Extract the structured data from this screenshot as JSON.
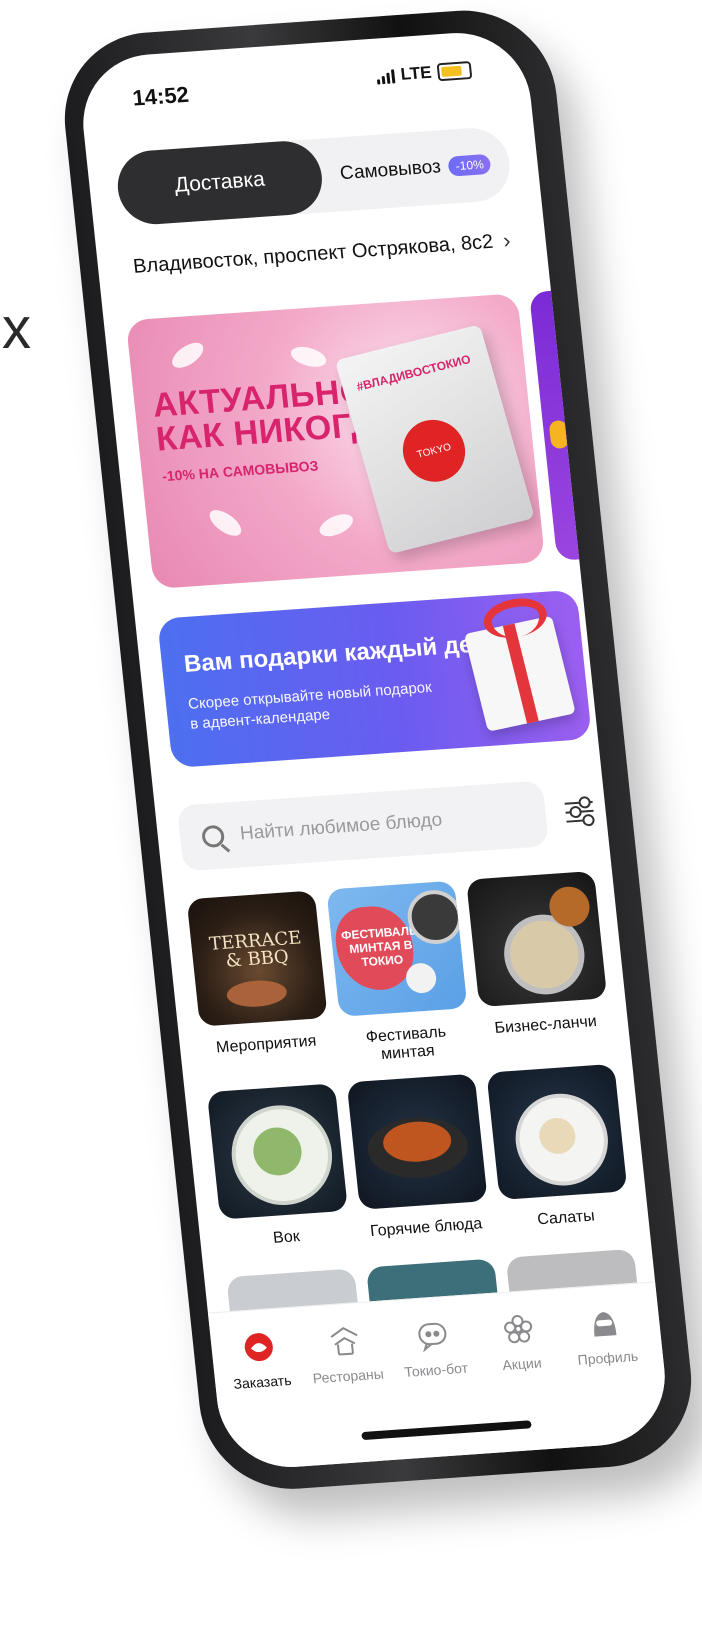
{
  "status_bar": {
    "time": "14:52",
    "network": "LTE"
  },
  "delivery_mode": {
    "options": [
      {
        "label": "Доставка",
        "active": true
      },
      {
        "label": "Самовывоз",
        "badge": "-10%"
      }
    ]
  },
  "address": {
    "text": "Владивосток, проспект Острякова, 8с2"
  },
  "promo_banner": {
    "title_line1": "АКТУАЛЬНО",
    "title_line2": "КАК НИКОГДА",
    "subtitle": "-10% НА САМОВЫВОЗ",
    "bag_tag": "#ВЛАДИВОСТОКИО",
    "bag_logo": "TOKYO"
  },
  "advent_banner": {
    "title": "Вам подарки каждый день!",
    "subtitle": "Скорее открывайте новый подарок в адвент-календаре"
  },
  "search": {
    "placeholder": "Найти любимое блюдо"
  },
  "categories": [
    {
      "label": "Мероприятия",
      "image_text_1": "TERRACE",
      "image_text_2": "& BBQ"
    },
    {
      "label": "Фестиваль минтая",
      "image_text": "ФЕСТИВАЛЬ МИНТАЯ В ТОКИО"
    },
    {
      "label": "Бизнес-ланчи"
    },
    {
      "label": "Вок"
    },
    {
      "label": "Горячие блюда"
    },
    {
      "label": "Салаты"
    }
  ],
  "bottom_nav": {
    "items": [
      {
        "label": "Заказать",
        "icon": "fish-logo-icon",
        "active": true
      },
      {
        "label": "Рестораны",
        "icon": "pagoda-icon"
      },
      {
        "label": "Токио-бот",
        "icon": "chat-bot-icon"
      },
      {
        "label": "Акции",
        "icon": "flower-icon"
      },
      {
        "label": "Профиль",
        "icon": "ninja-icon"
      }
    ]
  },
  "colors": {
    "accent_red": "#e02424",
    "segment_dark": "#2e2e30",
    "badge_purple": "#6d6cf5",
    "promo_pink": "#d8246d",
    "advent_blue": "#4d6ff0"
  }
}
